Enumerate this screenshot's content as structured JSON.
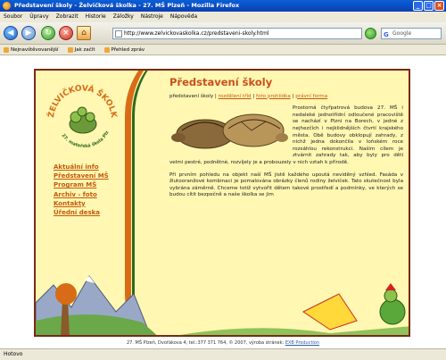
{
  "window": {
    "title": "Představení školy - Želvičková školka - 27. MŠ Plzeň - Mozilla Firefox"
  },
  "menubar": [
    "Soubor",
    "Úpravy",
    "Zobrazit",
    "Historie",
    "Záložky",
    "Nástroje",
    "Nápověda"
  ],
  "navbar": {
    "url": "http://www.zelvickovaskolka.cz/predstaveni-skoly.html",
    "search_placeholder": "Google"
  },
  "bookmarks": [
    "Nejnavštěvovanější",
    "Jak začít",
    "Přehled zpráv"
  ],
  "logo": {
    "title": "ŽELVIČKOVÁ ŠKOLKA",
    "subtitle": "27. mateřská škola Plzeň"
  },
  "sidemenu": [
    "Aktuální info",
    "Představení MŠ",
    "Program MŠ",
    "Archiv - foto",
    "Kontakty",
    "Úřední deska"
  ],
  "content": {
    "heading": "Představení školy",
    "subnav": {
      "current": "představení školy",
      "sep": "|",
      "links": [
        "rozdělení tříd",
        "foto prohlídka",
        "právní forma"
      ]
    },
    "p1": "Prostorná čtyřpatrová budova 27. MŠ i nedaleké jednotřídní odloučené pracoviště se nachází v Plzni na Borech, v jedné z nejhezčích i nejklidnějších čtvrtí krajského města. Obě budovy obklopují zahrady, z nichž jedna dokončila v loňském roce rozsáhlou rekonstrukci. Naším cílem je ztvárnit zahrady tak, aby byly pro děti velmi pestré, podnětné, rozvíjely je a probouzely v nich vztah k přírodě.",
    "p2": "Při prvním pohledu na objekt naší MŠ jistě každého upoutá neviděný vzhled. Fasáda v žlutooranžové kombinaci je pomalována obrázky členů rodiny želviček. Tato skutečnost byla vybrána záměrně. Chceme totiž vytvořit dětem takové prostředí a podmínky, ve kterých se budou cítit bezpečně a naše školka se jim"
  },
  "footer": {
    "text": "27. MŠ Plzeň, Dvořákova 4, tel.:377 371 764, © 2007, výroba stránek:",
    "link": "EXB Production"
  },
  "status": "Hotovo",
  "colors": {
    "accent": "#c9501c",
    "link": "#c45a0c",
    "page_bg": "#fff7b2",
    "border": "#7a2a12"
  }
}
